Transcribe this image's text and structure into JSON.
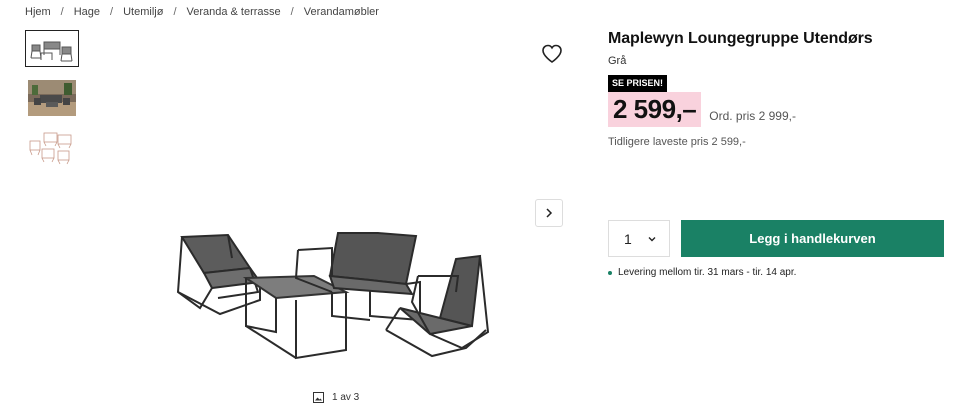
{
  "breadcrumb": [
    "Hjem",
    "Hage",
    "Utemiljø",
    "Veranda & terrasse",
    "Verandamøbler"
  ],
  "breadcrumb_separator": "/",
  "gallery": {
    "thumbnails": [
      "thumb-furniture-set",
      "thumb-lifestyle-photo",
      "thumb-sketch"
    ],
    "active_index": 0,
    "counter": "1 av 3"
  },
  "product": {
    "title": "Maplewyn Loungegruppe Utendørs",
    "color": "Grå",
    "badge": "SE PRISEN!",
    "price": "2 599,–",
    "ordinary_price": "Ord. pris 2 999,-",
    "lowest_price": "Tidligere laveste pris 2 599,-"
  },
  "purchase": {
    "quantity": "1",
    "add_to_cart": "Legg i handlekurven",
    "delivery": "Levering mellom tir. 31 mars - tir. 14 apr."
  },
  "colors": {
    "accent_green": "#1a8165",
    "price_highlight": "#f9d2dd",
    "badge_bg": "#000000"
  }
}
